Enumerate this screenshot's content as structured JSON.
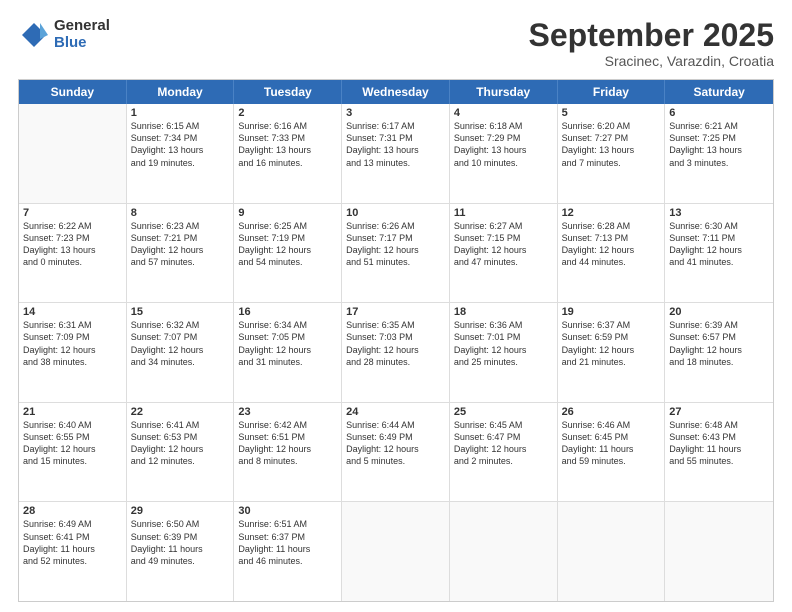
{
  "logo": {
    "general": "General",
    "blue": "Blue"
  },
  "header": {
    "month": "September 2025",
    "location": "Sracinec, Varazdin, Croatia"
  },
  "days": [
    "Sunday",
    "Monday",
    "Tuesday",
    "Wednesday",
    "Thursday",
    "Friday",
    "Saturday"
  ],
  "weeks": [
    [
      {
        "day": "",
        "content": ""
      },
      {
        "day": "1",
        "content": "Sunrise: 6:15 AM\nSunset: 7:34 PM\nDaylight: 13 hours\nand 19 minutes."
      },
      {
        "day": "2",
        "content": "Sunrise: 6:16 AM\nSunset: 7:33 PM\nDaylight: 13 hours\nand 16 minutes."
      },
      {
        "day": "3",
        "content": "Sunrise: 6:17 AM\nSunset: 7:31 PM\nDaylight: 13 hours\nand 13 minutes."
      },
      {
        "day": "4",
        "content": "Sunrise: 6:18 AM\nSunset: 7:29 PM\nDaylight: 13 hours\nand 10 minutes."
      },
      {
        "day": "5",
        "content": "Sunrise: 6:20 AM\nSunset: 7:27 PM\nDaylight: 13 hours\nand 7 minutes."
      },
      {
        "day": "6",
        "content": "Sunrise: 6:21 AM\nSunset: 7:25 PM\nDaylight: 13 hours\nand 3 minutes."
      }
    ],
    [
      {
        "day": "7",
        "content": "Sunrise: 6:22 AM\nSunset: 7:23 PM\nDaylight: 13 hours\nand 0 minutes."
      },
      {
        "day": "8",
        "content": "Sunrise: 6:23 AM\nSunset: 7:21 PM\nDaylight: 12 hours\nand 57 minutes."
      },
      {
        "day": "9",
        "content": "Sunrise: 6:25 AM\nSunset: 7:19 PM\nDaylight: 12 hours\nand 54 minutes."
      },
      {
        "day": "10",
        "content": "Sunrise: 6:26 AM\nSunset: 7:17 PM\nDaylight: 12 hours\nand 51 minutes."
      },
      {
        "day": "11",
        "content": "Sunrise: 6:27 AM\nSunset: 7:15 PM\nDaylight: 12 hours\nand 47 minutes."
      },
      {
        "day": "12",
        "content": "Sunrise: 6:28 AM\nSunset: 7:13 PM\nDaylight: 12 hours\nand 44 minutes."
      },
      {
        "day": "13",
        "content": "Sunrise: 6:30 AM\nSunset: 7:11 PM\nDaylight: 12 hours\nand 41 minutes."
      }
    ],
    [
      {
        "day": "14",
        "content": "Sunrise: 6:31 AM\nSunset: 7:09 PM\nDaylight: 12 hours\nand 38 minutes."
      },
      {
        "day": "15",
        "content": "Sunrise: 6:32 AM\nSunset: 7:07 PM\nDaylight: 12 hours\nand 34 minutes."
      },
      {
        "day": "16",
        "content": "Sunrise: 6:34 AM\nSunset: 7:05 PM\nDaylight: 12 hours\nand 31 minutes."
      },
      {
        "day": "17",
        "content": "Sunrise: 6:35 AM\nSunset: 7:03 PM\nDaylight: 12 hours\nand 28 minutes."
      },
      {
        "day": "18",
        "content": "Sunrise: 6:36 AM\nSunset: 7:01 PM\nDaylight: 12 hours\nand 25 minutes."
      },
      {
        "day": "19",
        "content": "Sunrise: 6:37 AM\nSunset: 6:59 PM\nDaylight: 12 hours\nand 21 minutes."
      },
      {
        "day": "20",
        "content": "Sunrise: 6:39 AM\nSunset: 6:57 PM\nDaylight: 12 hours\nand 18 minutes."
      }
    ],
    [
      {
        "day": "21",
        "content": "Sunrise: 6:40 AM\nSunset: 6:55 PM\nDaylight: 12 hours\nand 15 minutes."
      },
      {
        "day": "22",
        "content": "Sunrise: 6:41 AM\nSunset: 6:53 PM\nDaylight: 12 hours\nand 12 minutes."
      },
      {
        "day": "23",
        "content": "Sunrise: 6:42 AM\nSunset: 6:51 PM\nDaylight: 12 hours\nand 8 minutes."
      },
      {
        "day": "24",
        "content": "Sunrise: 6:44 AM\nSunset: 6:49 PM\nDaylight: 12 hours\nand 5 minutes."
      },
      {
        "day": "25",
        "content": "Sunrise: 6:45 AM\nSunset: 6:47 PM\nDaylight: 12 hours\nand 2 minutes."
      },
      {
        "day": "26",
        "content": "Sunrise: 6:46 AM\nSunset: 6:45 PM\nDaylight: 11 hours\nand 59 minutes."
      },
      {
        "day": "27",
        "content": "Sunrise: 6:48 AM\nSunset: 6:43 PM\nDaylight: 11 hours\nand 55 minutes."
      }
    ],
    [
      {
        "day": "28",
        "content": "Sunrise: 6:49 AM\nSunset: 6:41 PM\nDaylight: 11 hours\nand 52 minutes."
      },
      {
        "day": "29",
        "content": "Sunrise: 6:50 AM\nSunset: 6:39 PM\nDaylight: 11 hours\nand 49 minutes."
      },
      {
        "day": "30",
        "content": "Sunrise: 6:51 AM\nSunset: 6:37 PM\nDaylight: 11 hours\nand 46 minutes."
      },
      {
        "day": "",
        "content": ""
      },
      {
        "day": "",
        "content": ""
      },
      {
        "day": "",
        "content": ""
      },
      {
        "day": "",
        "content": ""
      }
    ]
  ]
}
